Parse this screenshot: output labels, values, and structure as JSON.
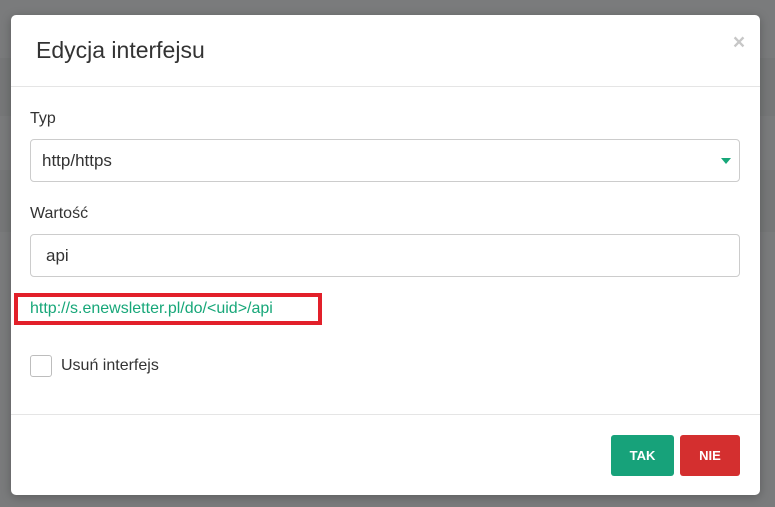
{
  "modal": {
    "title": "Edycja interfejsu",
    "close_symbol": "×",
    "close_icon": "close-icon"
  },
  "form": {
    "type_label": "Typ",
    "type_value": "http/https",
    "value_label": "Wartość",
    "value_input": "api",
    "url_text": "http://s.enewsletter.pl/do/<uid>/api",
    "delete_label": "Usuń interfejs",
    "delete_checked": false
  },
  "footer": {
    "yes_label": "TAK",
    "no_label": "NIE"
  },
  "colors": {
    "accent_green": "#17a27a",
    "danger_red": "#d42f2f",
    "highlight_red": "#e2202a",
    "link_green": "#17a779"
  }
}
